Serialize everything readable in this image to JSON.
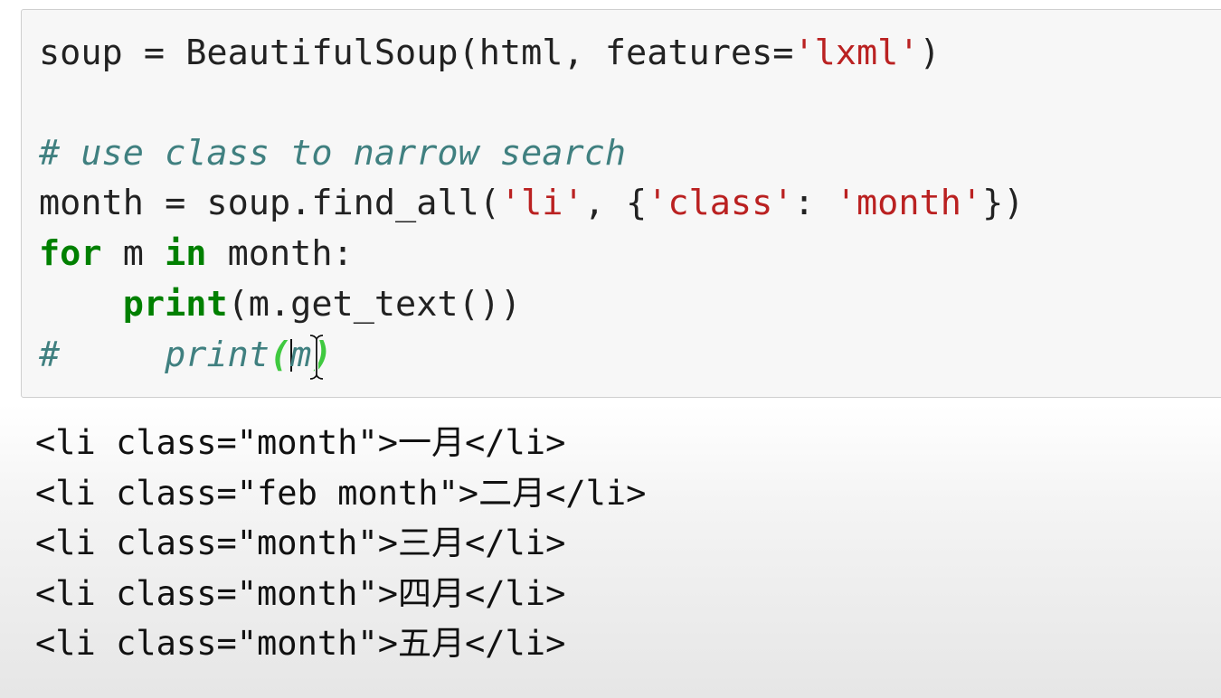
{
  "code_cell": {
    "line1": {
      "a": "soup = BeautifulSoup(html, features=",
      "s1": "'lxml'",
      "b": ")"
    },
    "line3": {
      "comment": "# use class to narrow search"
    },
    "line4": {
      "a": "month = soup.find_all(",
      "s1": "'li'",
      "b": ", {",
      "s2": "'class'",
      "c": ": ",
      "s3": "'month'",
      "d": "})"
    },
    "line5": {
      "kw1": "for",
      "a": " m ",
      "kw2": "in",
      "b": " month:"
    },
    "line6": {
      "indent": "    ",
      "kw": "print",
      "a": "(m.get_text())"
    },
    "line7": {
      "comment": "#     print",
      "open": "(",
      "arg": "m",
      "close": ")"
    }
  },
  "output": {
    "lines": [
      "<li class=\"month\">一月</li>",
      "<li class=\"feb month\">二月</li>",
      "<li class=\"month\">三月</li>",
      "<li class=\"month\">四月</li>",
      "<li class=\"month\">五月</li>"
    ]
  },
  "colors": {
    "keyword": "#008000",
    "string": "#ba2121",
    "comment": "#408080",
    "matched_paren": "#3fc93f",
    "cell_background": "#f7f7f7"
  },
  "icons": {
    "cursor": "text-ibeam-cursor"
  }
}
